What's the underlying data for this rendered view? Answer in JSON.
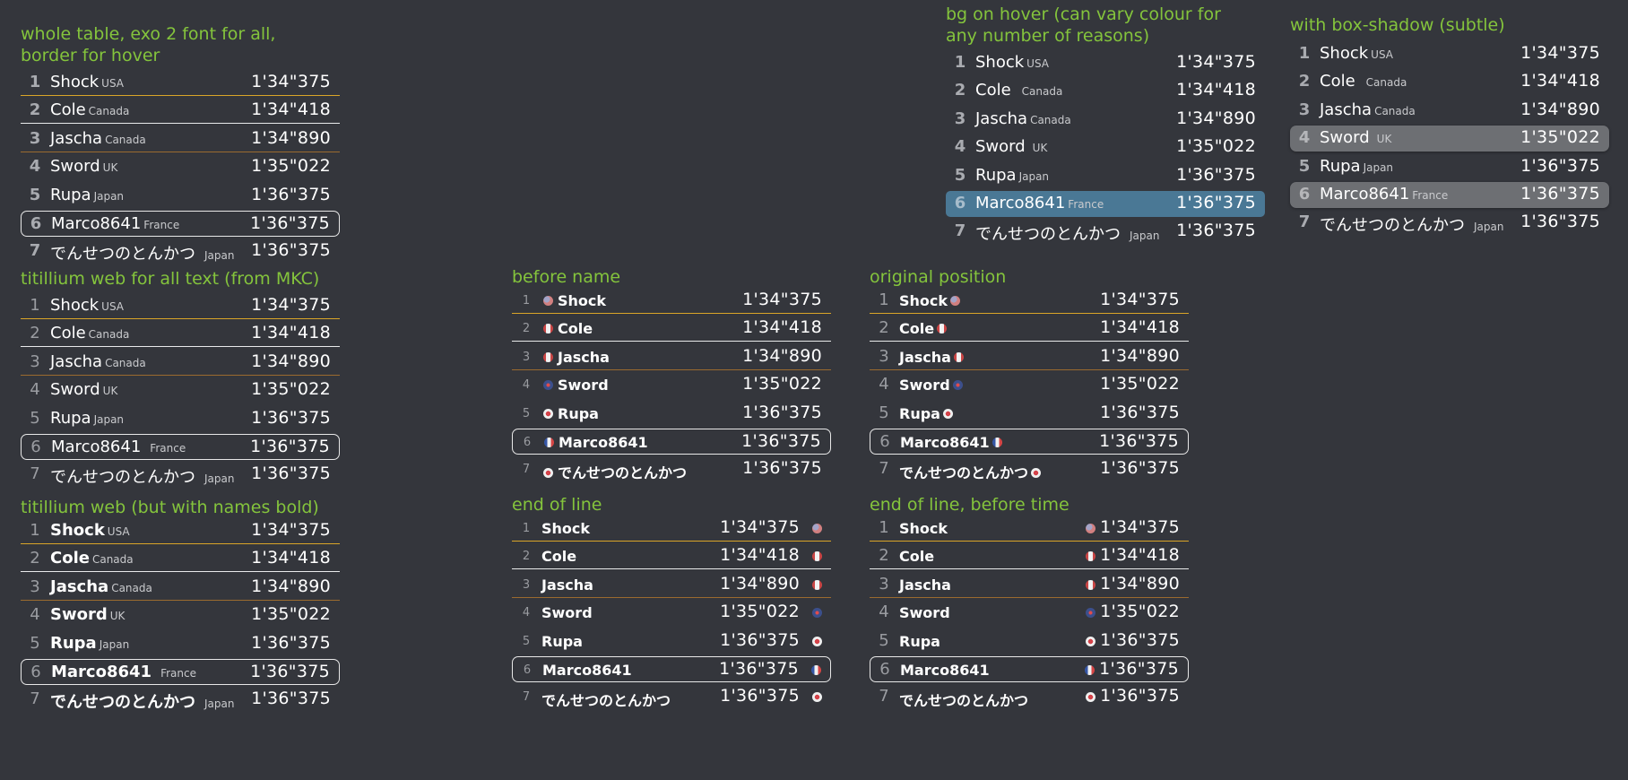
{
  "panels": [
    {
      "title": "whole table, exo 2 font for all, border for hover",
      "rows": [
        {
          "rank": "1",
          "name": "Shock",
          "country": "USA",
          "time": "1'34\"375"
        },
        {
          "rank": "2",
          "name": "Cole",
          "country": "Canada",
          "time": "1'34\"418"
        },
        {
          "rank": "3",
          "name": "Jascha",
          "country": "Canada",
          "time": "1'34\"890"
        },
        {
          "rank": "4",
          "name": "Sword",
          "country": "UK",
          "time": "1'35\"022"
        },
        {
          "rank": "5",
          "name": "Rupa",
          "country": "Japan",
          "time": "1'36\"375"
        },
        {
          "rank": "6",
          "name": "Marco8641",
          "country": "France",
          "time": "1'36\"375"
        },
        {
          "rank": "7",
          "name": "でんせつのとんかつ",
          "country": "Japan",
          "time": "1'36\"375"
        }
      ]
    },
    {
      "title": "titillium web for all text (from MKC)",
      "rows": [
        {
          "rank": "1",
          "name": "Shock",
          "country": "USA",
          "time": "1'34\"375"
        },
        {
          "rank": "2",
          "name": "Cole",
          "country": "Canada",
          "time": "1'34\"418"
        },
        {
          "rank": "3",
          "name": "Jascha",
          "country": "Canada",
          "time": "1'34\"890"
        },
        {
          "rank": "4",
          "name": "Sword",
          "country": "UK",
          "time": "1'35\"022"
        },
        {
          "rank": "5",
          "name": "Rupa",
          "country": "Japan",
          "time": "1'36\"375"
        },
        {
          "rank": "6",
          "name": "Marco8641",
          "country": "France",
          "time": "1'36\"375"
        },
        {
          "rank": "7",
          "name": "でんせつのとんかつ",
          "country": "Japan",
          "time": "1'36\"375"
        }
      ]
    },
    {
      "title": "titillium web (but with names bold)",
      "rows": [
        {
          "rank": "1",
          "name": "Shock",
          "country": "USA",
          "time": "1'34\"375"
        },
        {
          "rank": "2",
          "name": "Cole",
          "country": "Canada",
          "time": "1'34\"418"
        },
        {
          "rank": "3",
          "name": "Jascha",
          "country": "Canada",
          "time": "1'34\"890"
        },
        {
          "rank": "4",
          "name": "Sword",
          "country": "UK",
          "time": "1'35\"022"
        },
        {
          "rank": "5",
          "name": "Rupa",
          "country": "Japan",
          "time": "1'36\"375"
        },
        {
          "rank": "6",
          "name": "Marco8641",
          "country": "France",
          "time": "1'36\"375"
        },
        {
          "rank": "7",
          "name": "でんせつのとんかつ",
          "country": "Japan",
          "time": "1'36\"375"
        }
      ]
    },
    {
      "title": "before name",
      "rows": [
        {
          "rank": "1",
          "name": "Shock",
          "flag": "us-flag",
          "time": "1'34\"375"
        },
        {
          "rank": "2",
          "name": "Cole",
          "flag": "canada-flag",
          "time": "1'34\"418"
        },
        {
          "rank": "3",
          "name": "Jascha",
          "flag": "canada-flag",
          "time": "1'34\"890"
        },
        {
          "rank": "4",
          "name": "Sword",
          "flag": "uk-flag",
          "time": "1'35\"022"
        },
        {
          "rank": "5",
          "name": "Rupa",
          "flag": "japan-flag",
          "time": "1'36\"375"
        },
        {
          "rank": "6",
          "name": "Marco8641",
          "flag": "france-flag",
          "time": "1'36\"375"
        },
        {
          "rank": "7",
          "name": "でんせつのとんかつ",
          "flag": "japan-flag",
          "time": "1'36\"375"
        }
      ]
    },
    {
      "title": "original position",
      "rows": [
        {
          "rank": "1",
          "name": "Shock",
          "flag": "us-flag",
          "time": "1'34\"375"
        },
        {
          "rank": "2",
          "name": "Cole",
          "flag": "canada-flag",
          "time": "1'34\"418"
        },
        {
          "rank": "3",
          "name": "Jascha",
          "flag": "canada-flag",
          "time": "1'34\"890"
        },
        {
          "rank": "4",
          "name": "Sword",
          "flag": "uk-flag",
          "time": "1'35\"022"
        },
        {
          "rank": "5",
          "name": "Rupa",
          "flag": "japan-flag",
          "time": "1'36\"375"
        },
        {
          "rank": "6",
          "name": "Marco8641",
          "flag": "france-flag",
          "time": "1'36\"375"
        },
        {
          "rank": "7",
          "name": "でんせつのとんかつ",
          "flag": "japan-flag",
          "time": "1'36\"375"
        }
      ]
    },
    {
      "title": "end of line",
      "rows": [
        {
          "rank": "1",
          "name": "Shock",
          "flag": "us-flag",
          "time": "1'34\"375"
        },
        {
          "rank": "2",
          "name": "Cole",
          "flag": "canada-flag",
          "time": "1'34\"418"
        },
        {
          "rank": "3",
          "name": "Jascha",
          "flag": "canada-flag",
          "time": "1'34\"890"
        },
        {
          "rank": "4",
          "name": "Sword",
          "flag": "uk-flag",
          "time": "1'35\"022"
        },
        {
          "rank": "5",
          "name": "Rupa",
          "flag": "japan-flag",
          "time": "1'36\"375"
        },
        {
          "rank": "6",
          "name": "Marco8641",
          "flag": "france-flag",
          "time": "1'36\"375"
        },
        {
          "rank": "7",
          "name": "でんせつのとんかつ",
          "flag": "japan-flag",
          "time": "1'36\"375"
        }
      ]
    },
    {
      "title": "end of line, before time",
      "rows": [
        {
          "rank": "1",
          "name": "Shock",
          "flag": "us-flag",
          "time": "1'34\"375"
        },
        {
          "rank": "2",
          "name": "Cole",
          "flag": "canada-flag",
          "time": "1'34\"418"
        },
        {
          "rank": "3",
          "name": "Jascha",
          "flag": "canada-flag",
          "time": "1'34\"890"
        },
        {
          "rank": "4",
          "name": "Sword",
          "flag": "uk-flag",
          "time": "1'35\"022"
        },
        {
          "rank": "5",
          "name": "Rupa",
          "flag": "japan-flag",
          "time": "1'36\"375"
        },
        {
          "rank": "6",
          "name": "Marco8641",
          "flag": "france-flag",
          "time": "1'36\"375"
        },
        {
          "rank": "7",
          "name": "でんせつのとんかつ",
          "flag": "japan-flag",
          "time": "1'36\"375"
        }
      ]
    },
    {
      "title": "bg on hover (can vary colour for any number of reasons)",
      "rows": [
        {
          "rank": "1",
          "name": "Shock",
          "country": "USA",
          "time": "1'34\"375"
        },
        {
          "rank": "2",
          "name": "Cole",
          "country": "Canada",
          "time": "1'34\"418"
        },
        {
          "rank": "3",
          "name": "Jascha",
          "country": "Canada",
          "time": "1'34\"890"
        },
        {
          "rank": "4",
          "name": "Sword",
          "country": "UK",
          "time": "1'35\"022"
        },
        {
          "rank": "5",
          "name": "Rupa",
          "country": "Japan",
          "time": "1'36\"375"
        },
        {
          "rank": "6",
          "name": "Marco8641",
          "country": "France",
          "time": "1'36\"375"
        },
        {
          "rank": "7",
          "name": "でんせつのとんかつ",
          "country": "Japan",
          "time": "1'36\"375"
        }
      ]
    },
    {
      "title": "with box-shadow (subtle)",
      "rows": [
        {
          "rank": "1",
          "name": "Shock",
          "country": "USA",
          "time": "1'34\"375"
        },
        {
          "rank": "2",
          "name": "Cole",
          "country": "Canada",
          "time": "1'34\"418"
        },
        {
          "rank": "3",
          "name": "Jascha",
          "country": "Canada",
          "time": "1'34\"890"
        },
        {
          "rank": "4",
          "name": "Sword",
          "country": "UK",
          "time": "1'35\"022"
        },
        {
          "rank": "5",
          "name": "Rupa",
          "country": "Japan",
          "time": "1'36\"375"
        },
        {
          "rank": "6",
          "name": "Marco8641",
          "country": "France",
          "time": "1'36\"375"
        },
        {
          "rank": "7",
          "name": "でんせつのとんかつ",
          "country": "Japan",
          "time": "1'36\"375"
        }
      ]
    }
  ],
  "colors": {
    "background": "#34363c",
    "title_green": "#84c43c",
    "gold_line": "#d9a528",
    "hover_blue": "#4a7895",
    "hover_gray": "#6d6f73"
  }
}
